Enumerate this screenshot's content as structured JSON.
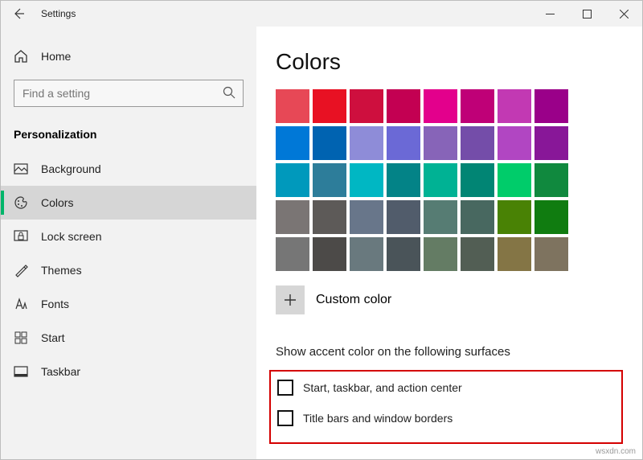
{
  "titlebar": {
    "title": "Settings"
  },
  "sidebar": {
    "home": "Home",
    "search_placeholder": "Find a setting",
    "category": "Personalization",
    "items": [
      {
        "icon": "background",
        "label": "Background"
      },
      {
        "icon": "colors",
        "label": "Colors"
      },
      {
        "icon": "lockscreen",
        "label": "Lock screen"
      },
      {
        "icon": "themes",
        "label": "Themes"
      },
      {
        "icon": "fonts",
        "label": "Fonts"
      },
      {
        "icon": "start",
        "label": "Start"
      },
      {
        "icon": "taskbar",
        "label": "Taskbar"
      }
    ]
  },
  "main": {
    "heading": "Colors",
    "swatches": [
      "#e74856",
      "#e81123",
      "#ce0f3e",
      "#c30052",
      "#e3008c",
      "#bf0077",
      "#c239b3",
      "#9a0089",
      "#0078d7",
      "#0063b1",
      "#8e8cd8",
      "#6b69d6",
      "#8764b8",
      "#744da9",
      "#b146c2",
      "#881798",
      "#0099bc",
      "#2d7d9a",
      "#00b7c3",
      "#038387",
      "#00b294",
      "#018574",
      "#00cc6a",
      "#10893e",
      "#7a7574",
      "#5d5a58",
      "#68768a",
      "#515c6b",
      "#567c73",
      "#486860",
      "#498205",
      "#107c10",
      "#767676",
      "#4c4a48",
      "#69797e",
      "#4a5459",
      "#647c64",
      "#525e54",
      "#847545",
      "#7e735f"
    ],
    "custom_color_label": "Custom color",
    "accent_section_title": "Show accent color on the following surfaces",
    "checkboxes": [
      "Start, taskbar, and action center",
      "Title bars and window borders"
    ]
  },
  "watermark": "wsxdn.com"
}
